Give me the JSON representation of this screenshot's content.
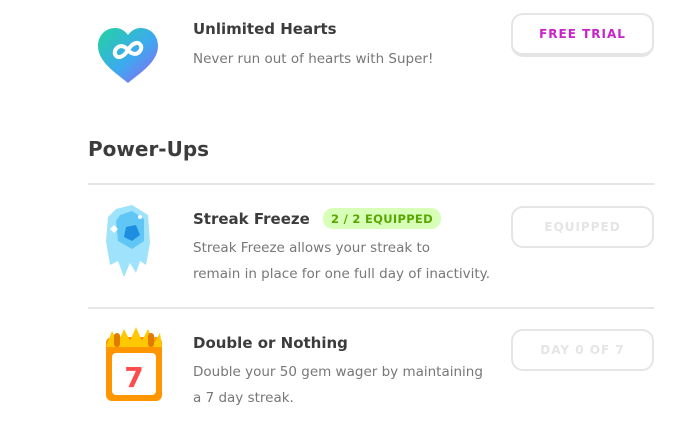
{
  "super_item": {
    "title": "Unlimited Hearts",
    "description": "Never run out of hearts with Super!",
    "button_label": "FREE TRIAL",
    "icon": "infinity-heart-icon"
  },
  "powerups": {
    "section_title": "Power-Ups",
    "items": [
      {
        "title": "Streak Freeze",
        "badge": "2 / 2 EQUIPPED",
        "description_line1": "Streak Freeze allows your streak to",
        "description_line2": "remain in place for one full day of inactivity.",
        "button_label": "EQUIPPED",
        "icon": "ice-cube-icon"
      },
      {
        "title": "Double or Nothing",
        "description_line1": "Double your 50 gem wager by maintaining",
        "description_line2": "a 7 day streak.",
        "button_label": "DAY 0 OF 7",
        "icon": "calendar-7-icon",
        "calendar_number": "7"
      }
    ]
  },
  "colors": {
    "trial_text": "#c822c8",
    "badge_bg": "#d7ffb8",
    "badge_text": "#58a700",
    "disabled_text": "#e5e5e5"
  }
}
